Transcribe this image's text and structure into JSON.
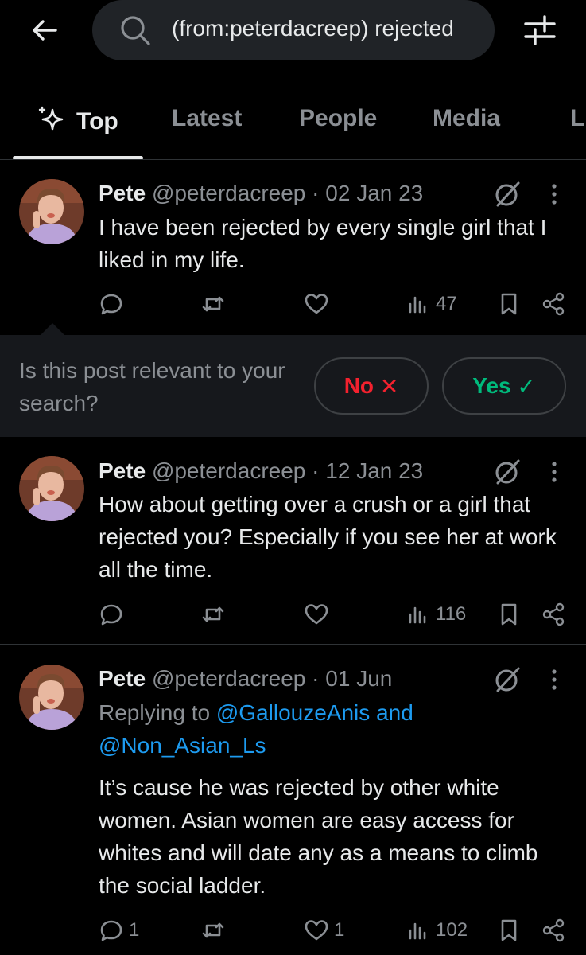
{
  "search": {
    "query": "(from:peterdacreep) rejected"
  },
  "tabs": [
    "Top",
    "Latest",
    "People",
    "Media",
    "L"
  ],
  "posts": [
    {
      "name": "Pete",
      "handle": "@peterdacreep",
      "sep": "·",
      "date": "02 Jan 23",
      "text": "I have been rejected by every single girl that I liked in my life.",
      "replies": "",
      "likes": "",
      "views": "47"
    },
    {
      "name": "Pete",
      "handle": "@peterdacreep",
      "sep": "·",
      "date": "12 Jan 23",
      "text": "How about getting over a crush or a girl that rejected you? Especially if you see her at work all the time.",
      "replies": "",
      "likes": "",
      "views": "116"
    },
    {
      "name": "Pete",
      "handle": "@peterdacreep",
      "sep": "·",
      "date": "01 Jun",
      "replying_prefix": "Replying to",
      "mention1": "@GallouzeAnis",
      "and": "and",
      "mention2": "@Non_Asian_Ls",
      "text": "It’s cause he was rejected by other white women. Asian women are easy access for whites and will date any as a means to climb the social ladder.",
      "replies": "1",
      "likes": "1",
      "views": "102"
    }
  ],
  "relevance": {
    "question": "Is this post relevant to your search?",
    "no_label": "No",
    "no_symbol": "✕",
    "yes_label": "Yes",
    "yes_symbol": "✓"
  },
  "colors": {
    "accent": "#1d9bf0",
    "no": "#f4212e",
    "yes": "#00ba7c",
    "muted": "#8b8f94"
  }
}
